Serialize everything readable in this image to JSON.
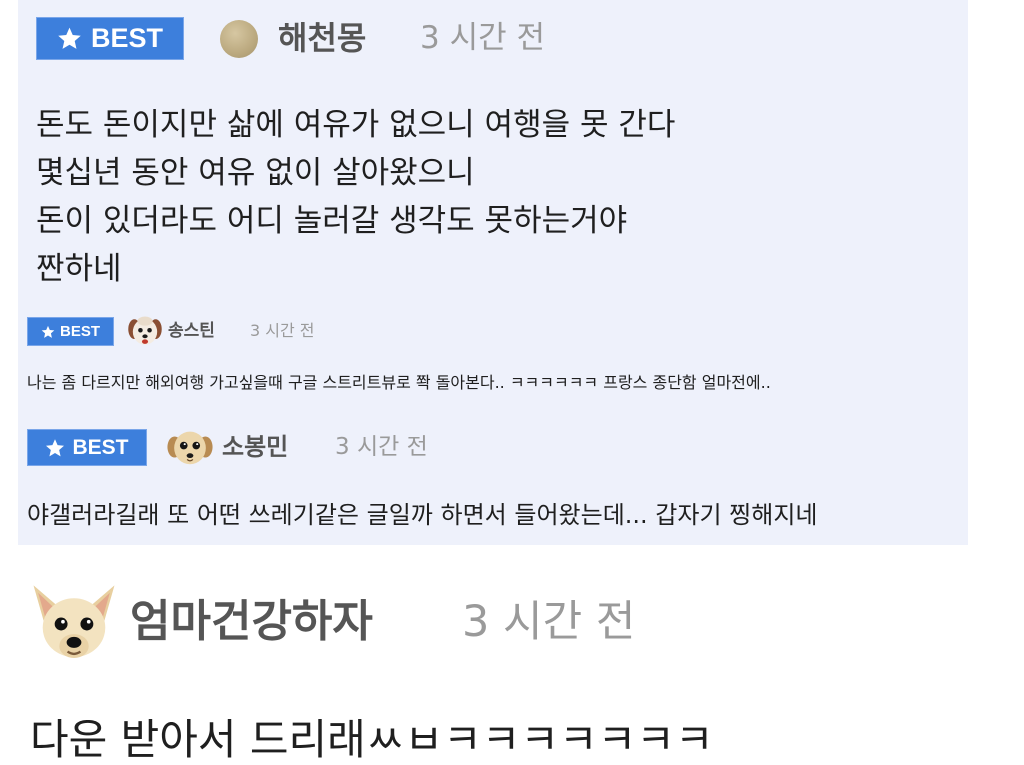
{
  "colors": {
    "panel_background": "#eef1fb",
    "page_background": "#ffffff",
    "best_badge": "#3d7fdc",
    "best_badge_text": "#ffffff",
    "username": "#555555",
    "timestamp": "#9a9a9a",
    "body_text": "#1f1f1f"
  },
  "best_comments": [
    {
      "badge": {
        "icon": "star-icon",
        "label": "BEST"
      },
      "avatar_icon": "profile-circle-icon",
      "username": "해천몽",
      "time": "3 시간 전",
      "lines": [
        "돈도 돈이지만 삶에 여유가 없으니 여행을 못 간다",
        "몇십년 동안 여유 없이 살아왔으니",
        "돈이 있더라도 어디 놀러갈 생각도 못하는거야",
        "짠하네"
      ]
    },
    {
      "badge": {
        "icon": "star-icon",
        "label": "BEST"
      },
      "avatar_icon": "dog-avatar-icon",
      "username": "송스틴",
      "time": "3 시간 전",
      "lines": [
        "나는 좀 다르지만 해외여행 가고싶을때 구글 스트리트뷰로 쫙 돌아본다.. ㅋㅋㅋㅋㅋㅋ 프랑스 종단함 얼마전에.."
      ]
    },
    {
      "badge": {
        "icon": "star-icon",
        "label": "BEST"
      },
      "avatar_icon": "puppy-avatar-icon",
      "username": "소봉민",
      "time": "3 시간 전",
      "lines": [
        "야갤러라길래 또 어떤 쓰레기같은 글일까 하면서 들어왔는데... 갑자기 찡해지네"
      ]
    }
  ],
  "comment": {
    "avatar_icon": "chihuahua-avatar-icon",
    "username": "엄마건강하자",
    "time": "3 시간 전",
    "lines": [
      "다운 받아서 드리래ㅆㅂㅋㅋㅋㅋㅋㅋㅋ"
    ]
  }
}
